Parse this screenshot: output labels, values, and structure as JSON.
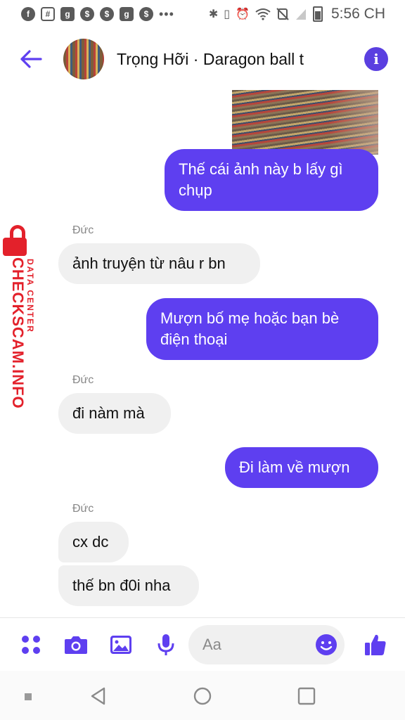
{
  "status_bar": {
    "time": "5:56 CH",
    "icons": [
      "facebook-icon",
      "grid-icon",
      "app-g-icon",
      "app-s-icon",
      "app-s-icon",
      "app-g-icon",
      "app-s-icon",
      "more-dots-icon",
      "bluetooth-icon",
      "vibrate-icon",
      "alarm-icon",
      "wifi-icon",
      "no-sim-icon",
      "signal-icon",
      "battery-icon"
    ],
    "dots": "•••"
  },
  "header": {
    "title": "Trọng Hỡi · Daragon ball t",
    "back_icon": "back-arrow-icon",
    "info_icon": "info-icon"
  },
  "colors": {
    "accent": "#5e3ff0",
    "incoming_bubble": "#f0f0f0",
    "watermark": "#e3212b"
  },
  "watermark": {
    "main": "CHECKSCAM.INFO",
    "sub": "DATA CENTER"
  },
  "messages": [
    {
      "type": "image",
      "direction": "outgoing"
    },
    {
      "direction": "outgoing",
      "text": "Thế cái ảnh này b lấy gì chụp"
    },
    {
      "direction": "incoming",
      "sender": "Đức",
      "text": "ảnh truyện từ nâu r bn"
    },
    {
      "direction": "outgoing",
      "text": "Mượn bố mẹ hoặc bạn bè điện thoại"
    },
    {
      "direction": "incoming",
      "sender": "Đức",
      "text": "đi nàm mà"
    },
    {
      "direction": "outgoing",
      "text": "Đi làm về mượn"
    },
    {
      "direction": "incoming",
      "sender": "Đức",
      "text": "cx dc"
    },
    {
      "direction": "incoming",
      "text": "thế bn đ0i nha"
    }
  ],
  "composer": {
    "placeholder": "Aa",
    "buttons": [
      "apps-icon",
      "camera-icon",
      "gallery-icon",
      "microphone-icon",
      "emoji-icon",
      "thumbs-up-icon"
    ]
  },
  "navbar": {
    "buttons": [
      "recent-dot-icon",
      "back-triangle-icon",
      "home-circle-icon",
      "overview-square-icon"
    ]
  }
}
